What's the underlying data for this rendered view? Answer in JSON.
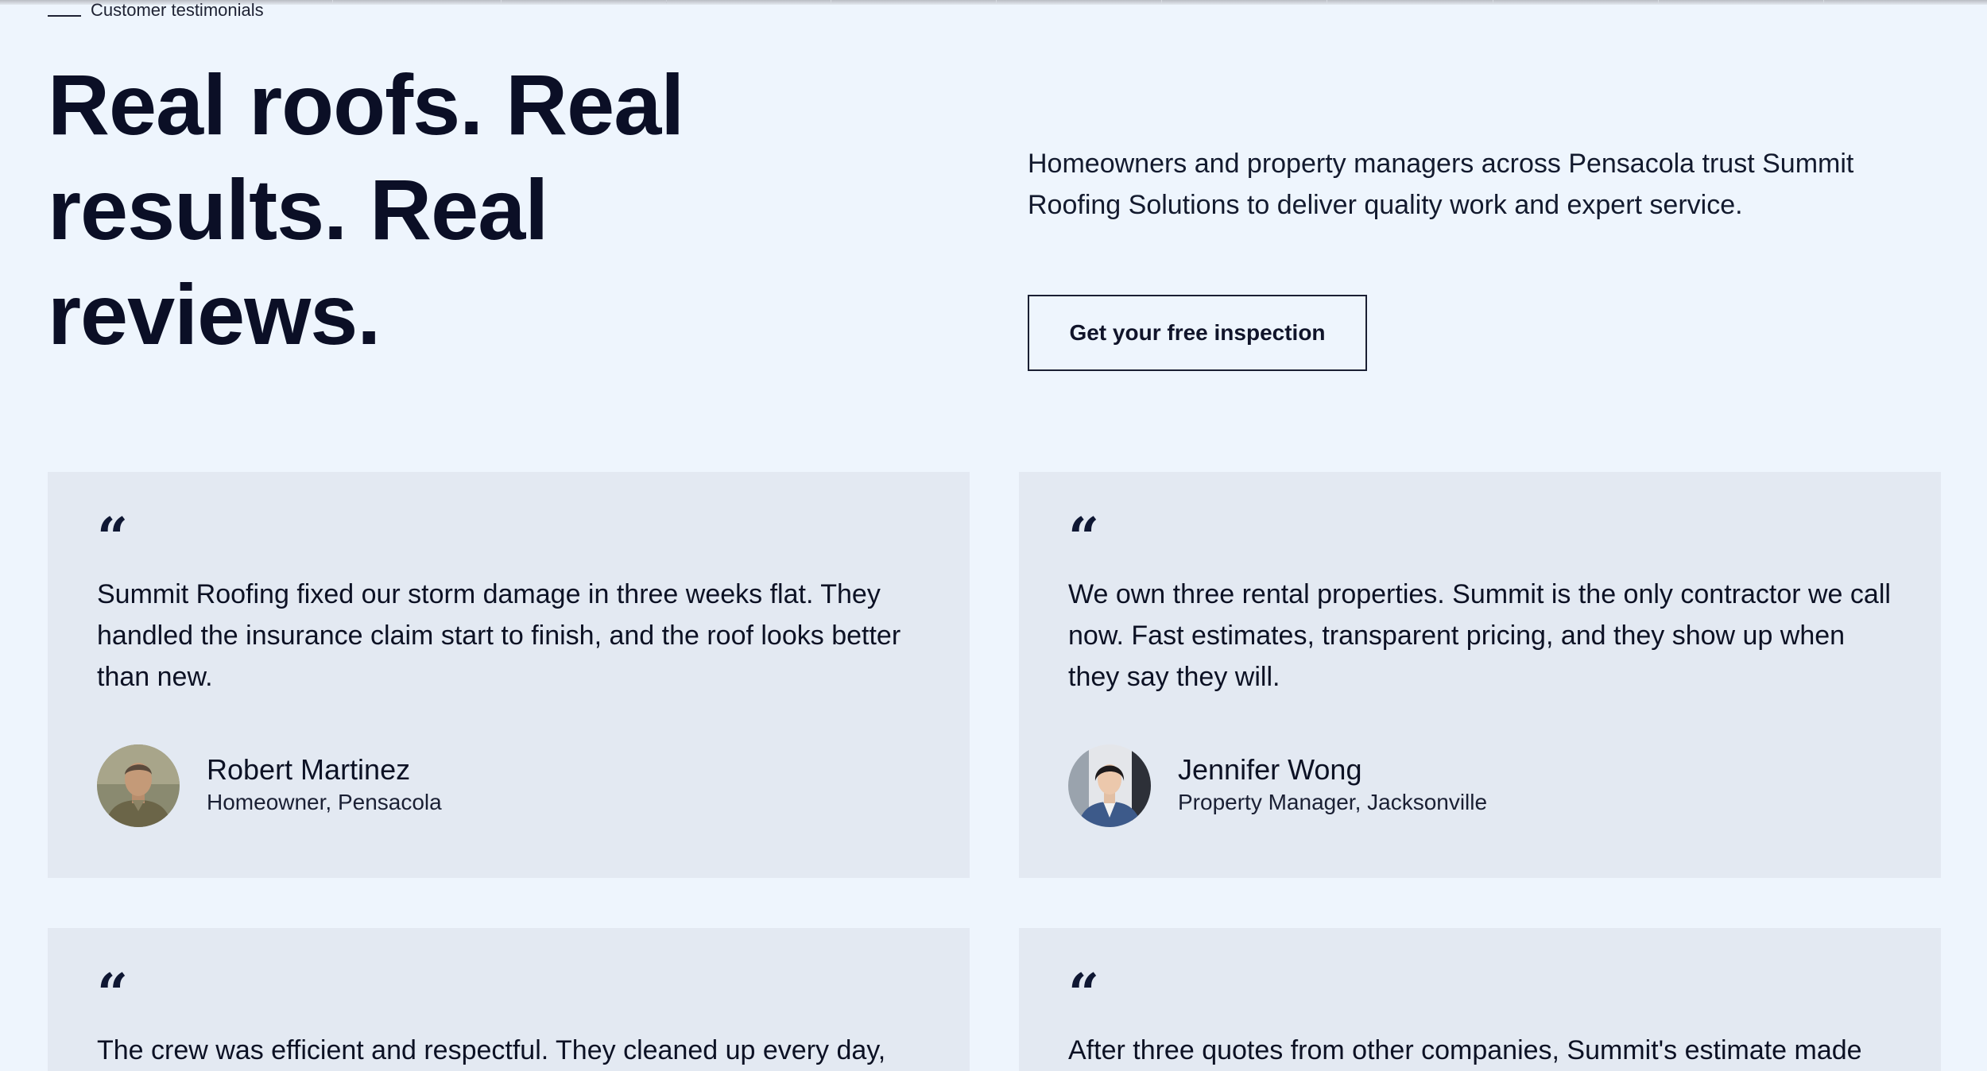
{
  "section": {
    "eyebrow": "Customer testimonials",
    "headline": "Real roofs. Real results. Real reviews.",
    "intro": "Homeowners and property managers across Pensacola trust Summit Roofing Solutions to deliver quality work and expert service.",
    "cta_label": "Get your free inspection"
  },
  "testimonials": [
    {
      "quote_mark": "“",
      "text": "Summit Roofing fixed our storm damage in three weeks flat. They handled the insurance claim start to finish, and the roof looks better than new.",
      "name": "Robert Martinez",
      "role": "Homeowner, Pensacola"
    },
    {
      "quote_mark": "“",
      "text": "We own three rental properties. Summit is the only contractor we call now. Fast estimates, transparent pricing, and they show up when they say they will.",
      "name": "Jennifer Wong",
      "role": "Property Manager, Jacksonville"
    },
    {
      "quote_mark": "“",
      "text": "The crew was efficient and respectful. They cleaned up every day,"
    },
    {
      "quote_mark": "“",
      "text": "After three quotes from other companies, Summit's estimate made"
    }
  ],
  "colors": {
    "page_background": "#eef5fd",
    "card_background": "#e3e9f2",
    "heading": "#0b0f26"
  }
}
